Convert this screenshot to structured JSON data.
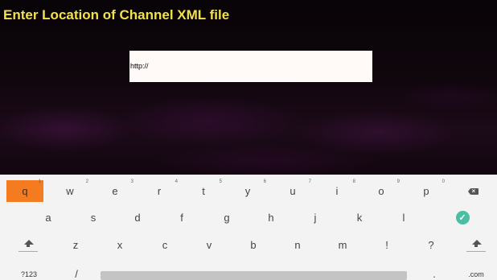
{
  "header": {
    "title": "Enter Location of Channel XML file"
  },
  "input": {
    "value": "http://"
  },
  "keyboard": {
    "row1": [
      {
        "label": "q",
        "hint": "1"
      },
      {
        "label": "w",
        "hint": "2"
      },
      {
        "label": "e",
        "hint": "3"
      },
      {
        "label": "r",
        "hint": "4"
      },
      {
        "label": "t",
        "hint": "5"
      },
      {
        "label": "y",
        "hint": "6"
      },
      {
        "label": "u",
        "hint": "7"
      },
      {
        "label": "i",
        "hint": "8"
      },
      {
        "label": "o",
        "hint": "9"
      },
      {
        "label": "p",
        "hint": "0"
      }
    ],
    "row2": [
      "a",
      "s",
      "d",
      "f",
      "g",
      "h",
      "j",
      "k",
      "l"
    ],
    "row3": [
      "z",
      "x",
      "c",
      "v",
      "b",
      "n",
      "m",
      "!",
      "?"
    ],
    "row4": {
      "symbols": "?123",
      "slash": "/",
      "period": ".",
      "dotcom": ".com"
    },
    "icons": {
      "backspace": "backspace-icon",
      "enter": "check-icon",
      "shift": "shift-icon"
    },
    "colors": {
      "active_key": "#f47b20",
      "enter": "#4cbea1",
      "title": "#f2e24a"
    }
  }
}
